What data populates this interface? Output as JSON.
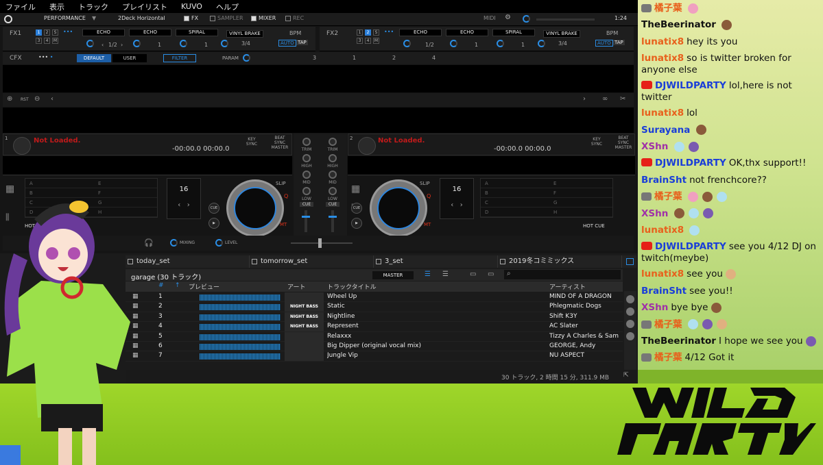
{
  "menu": [
    "ファイル",
    "表示",
    "トラック",
    "プレイリスト",
    "KUVO",
    "ヘルプ"
  ],
  "toolbar": {
    "mode": "PERFORMANCE",
    "layout": "2Deck Horizontal",
    "fx": "FX",
    "sampler": "SAMPLER",
    "mixer": "MIXER",
    "rec": "REC",
    "midi": "MIDI",
    "time": "1:24"
  },
  "fx1": {
    "label": "FX1",
    "slots": [
      "ECHO",
      "ECHO",
      "SPIRAL",
      "VINYL BRAKE"
    ],
    "beats": [
      "1/2",
      "1",
      "1",
      "3/4"
    ],
    "bpm": "BPM",
    "auto": "AUTO",
    "tap": "TAP"
  },
  "fx2": {
    "label": "FX2",
    "slots": [
      "ECHO",
      "ECHO",
      "SPIRAL",
      "VINYL BRAKE"
    ],
    "beats": [
      "1/2",
      "1",
      "1",
      "3/4"
    ],
    "bpm": "BPM",
    "auto": "AUTO",
    "tap": "TAP"
  },
  "cfx": {
    "label": "CFX",
    "default": "DEFAULT",
    "user": "USER",
    "filter": "FILTER",
    "param": "PARAM",
    "nums": [
      "3",
      "1",
      "2",
      "4"
    ]
  },
  "rst": "RST",
  "decks": [
    {
      "num": "1",
      "status": "Not Loaded.",
      "time": "-00:00.0  00:00.0",
      "key": "KEY SYNC",
      "beat": "BEAT SYNC MASTER",
      "beatnum": "16",
      "slip": "SLIP",
      "q": "Q",
      "mt": "MT",
      "cue": "CUE",
      "hc": "HOT CUE"
    },
    {
      "num": "2",
      "status": "Not Loaded.",
      "time": "-00:00.0  00:00.0",
      "key": "KEY SYNC",
      "beat": "BEAT SYNC MASTER",
      "beatnum": "16",
      "slip": "SLIP",
      "q": "Q",
      "mt": "MT",
      "cue": "CUE",
      "hc": "HOT CUE"
    }
  ],
  "hotcue_letters": [
    "A",
    "B",
    "C",
    "D",
    "E",
    "F",
    "G",
    "H"
  ],
  "mixer": {
    "trim": "TRIM",
    "high": "HIGH",
    "mid": "MID",
    "low": "LOW",
    "cue": "CUE",
    "mixing": "MIXING",
    "level": "LEVEL"
  },
  "tabs": [
    "today_set",
    "tomorrow_set",
    "3_set",
    "2019冬コミミックス"
  ],
  "playlist": {
    "title": "garage (30 トラック)",
    "master": "MASTER"
  },
  "columns": [
    "#",
    "プレビュー",
    "アート",
    "トラックタイトル",
    "アーティスト"
  ],
  "tracks": [
    {
      "n": "1",
      "title": "Wheel Up",
      "artist": "MIND OF A DRAGON",
      "art": ""
    },
    {
      "n": "2",
      "title": "Static",
      "artist": "Phlegmatic Dogs",
      "art": "NIGHT BASS"
    },
    {
      "n": "3",
      "title": "Nightline",
      "artist": "Shift K3Y",
      "art": "NIGHT BASS"
    },
    {
      "n": "4",
      "title": "Represent",
      "artist": "AC Slater",
      "art": "NIGHT BASS"
    },
    {
      "n": "5",
      "title": "Relaxxx",
      "artist": "Tizzy A Charles & Sam",
      "art": ""
    },
    {
      "n": "6",
      "title": "Big Dipper (original vocal mix)",
      "artist": "GEORGE, Andy",
      "art": ""
    },
    {
      "n": "7",
      "title": "Jungle Vip",
      "artist": "NU ASPECT",
      "art": ""
    }
  ],
  "status": "30 トラック, 2 時間 15 分, 311.9 MB",
  "chat": [
    {
      "name": "橘子葉",
      "color": "#e8601c",
      "text": "",
      "icon": "sticker",
      "emotes": 1
    },
    {
      "name": "TheBeerinator",
      "color": "#111",
      "text": "",
      "icon": "",
      "emotes": 1
    },
    {
      "name": "lunatix8",
      "color": "#e8601c",
      "text": "hey its you",
      "icon": "",
      "emotes": 0
    },
    {
      "name": "lunatix8",
      "color": "#e8601c",
      "text": "so is twitter broken for anyone else",
      "icon": "",
      "emotes": 0
    },
    {
      "name": "DJWILDPARTY",
      "color": "#1a3ed8",
      "text": "lol,here is not twitter",
      "icon": "yt",
      "emotes": 0
    },
    {
      "name": "lunatix8",
      "color": "#e8601c",
      "text": "lol",
      "icon": "",
      "emotes": 0
    },
    {
      "name": "Surayana",
      "color": "#1a3ed8",
      "text": "",
      "icon": "",
      "emotes": 1
    },
    {
      "name": "XShn",
      "color": "#a030a8",
      "text": "",
      "icon": "",
      "emotes": 2
    },
    {
      "name": "DJWILDPARTY",
      "color": "#1a3ed8",
      "text": "OK,thx support!!",
      "icon": "yt",
      "emotes": 0
    },
    {
      "name": "BrainSht",
      "color": "#1a3ed8",
      "text": "not frenchcore??",
      "icon": "",
      "emotes": 0
    },
    {
      "name": "橘子葉",
      "color": "#e8601c",
      "text": "",
      "icon": "sticker",
      "emotes": 3
    },
    {
      "name": "XShn",
      "color": "#a030a8",
      "text": "",
      "icon": "",
      "emotes": 3
    },
    {
      "name": "lunatix8",
      "color": "#e8601c",
      "text": "",
      "icon": "",
      "emotes": 1
    },
    {
      "name": "DJWILDPARTY",
      "color": "#1a3ed8",
      "text": "see you 4/12 DJ on twitch(meybe)",
      "icon": "yt",
      "emotes": 0
    },
    {
      "name": "lunatix8",
      "color": "#e8601c",
      "text": "see you",
      "icon": "",
      "emotes": 1
    },
    {
      "name": "BrainSht",
      "color": "#1a3ed8",
      "text": "see you!!",
      "icon": "",
      "emotes": 0
    },
    {
      "name": "XShn",
      "color": "#a030a8",
      "text": "bye bye",
      "icon": "",
      "emotes": 1
    },
    {
      "name": "橘子葉",
      "color": "#e8601c",
      "text": "",
      "icon": "sticker",
      "emotes": 3
    },
    {
      "name": "TheBeerinator",
      "color": "#111",
      "text": "I hope we see you",
      "icon": "",
      "emotes": 1
    },
    {
      "name": "橘子葉",
      "color": "#e8601c",
      "text": "4/12 Got it",
      "icon": "sticker",
      "emotes": 0
    }
  ],
  "colors": {
    "accent": "#2a8ee6",
    "chatBg": "#d4e59a",
    "bottomBar": "#93cc24",
    "logo": "#0b0b0b"
  }
}
